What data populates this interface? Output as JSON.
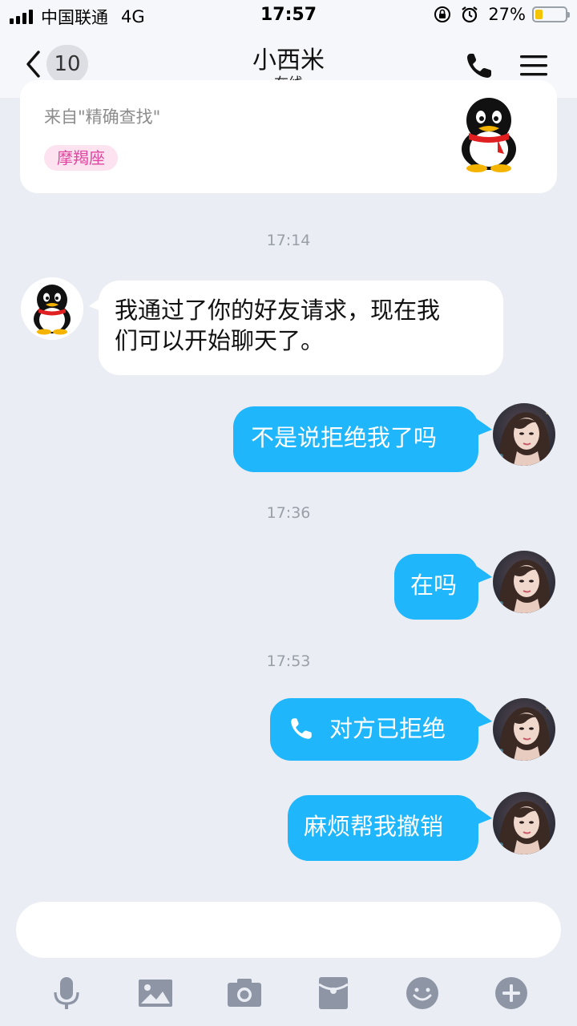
{
  "status_bar": {
    "carrier": "中国联通",
    "network": "4G",
    "time": "17:57",
    "battery_percent": "27%",
    "battery_level": 0.27,
    "battery_color": "#f5c400"
  },
  "nav": {
    "back_icon": "chevron-left-icon",
    "unread_count": "10",
    "contact_name": "小西米",
    "contact_status": "在线",
    "call_icon": "phone-icon",
    "menu_icon": "menu-icon"
  },
  "profile_card": {
    "source": "来自\"精确查找\"",
    "zodiac": "摩羯座",
    "avatar_icon": "qq-penguin-icon"
  },
  "chat": {
    "accent_color": "#1fb6fb",
    "timestamps": [
      "17:14",
      "17:36",
      "17:53"
    ],
    "messages": [
      {
        "from": "contact",
        "text_line1": "我通过了你的好友请求，现在我",
        "text_line2": "们可以开始聊天了。"
      },
      {
        "from": "me",
        "text": "不是说拒绝我了吗"
      },
      {
        "from": "me",
        "text": "在吗"
      },
      {
        "from": "me",
        "text": "对方已拒绝",
        "icon": "phone-icon"
      },
      {
        "from": "me",
        "text": "麻烦帮我撤销"
      }
    ]
  },
  "toolbar": {
    "items": [
      "microphone-icon",
      "image-icon",
      "camera-icon",
      "red-packet-icon",
      "emoji-icon",
      "plus-icon"
    ]
  }
}
